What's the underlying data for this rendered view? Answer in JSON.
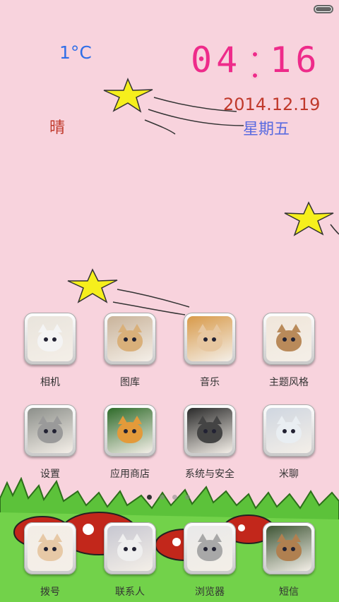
{
  "status_bar": {
    "battery_icon": "battery-icon"
  },
  "widget": {
    "temperature": "1°C",
    "weather": "晴",
    "time": "04 16",
    "time_hours": "04",
    "time_minutes": "16",
    "date": "2014.12.19",
    "weekday": "星期五"
  },
  "apps_row1": [
    {
      "label": "相机",
      "color": "#e9e4dc",
      "cat": "#f4f4f4"
    },
    {
      "label": "图库",
      "color": "#c9b39a",
      "cat": "#d9b07a"
    },
    {
      "label": "音乐",
      "color": "#d89a4a",
      "cat": "#e7c7a0"
    },
    {
      "label": "主题风格",
      "color": "#f0e6da",
      "cat": "#b98a5a"
    }
  ],
  "apps_row2": [
    {
      "label": "设置",
      "color": "#8c8f8a",
      "cat": "#9a9a9a"
    },
    {
      "label": "应用商店",
      "color": "#2f6b2a",
      "cat": "#e39a3a"
    },
    {
      "label": "系统与安全",
      "color": "#2a2a2a",
      "cat": "#444"
    },
    {
      "label": "米聊",
      "color": "#cfd6e0",
      "cat": "#e9eef2"
    }
  ],
  "dock": [
    {
      "label": "拨号",
      "color": "#f3ede6",
      "cat": "#e7c9a6"
    },
    {
      "label": "联系人",
      "color": "#c7c7d1",
      "cat": "#efefef"
    },
    {
      "label": "浏览器",
      "color": "#e9e9e9",
      "cat": "#a8a8a8"
    },
    {
      "label": "短信",
      "color": "#3f5636",
      "cat": "#b08050"
    }
  ],
  "page_indicator": {
    "count": 4,
    "current": 1
  },
  "colors": {
    "wallpaper": "#f8d3dd",
    "grass": "#5cc23a",
    "time": "#ee2b8a"
  }
}
